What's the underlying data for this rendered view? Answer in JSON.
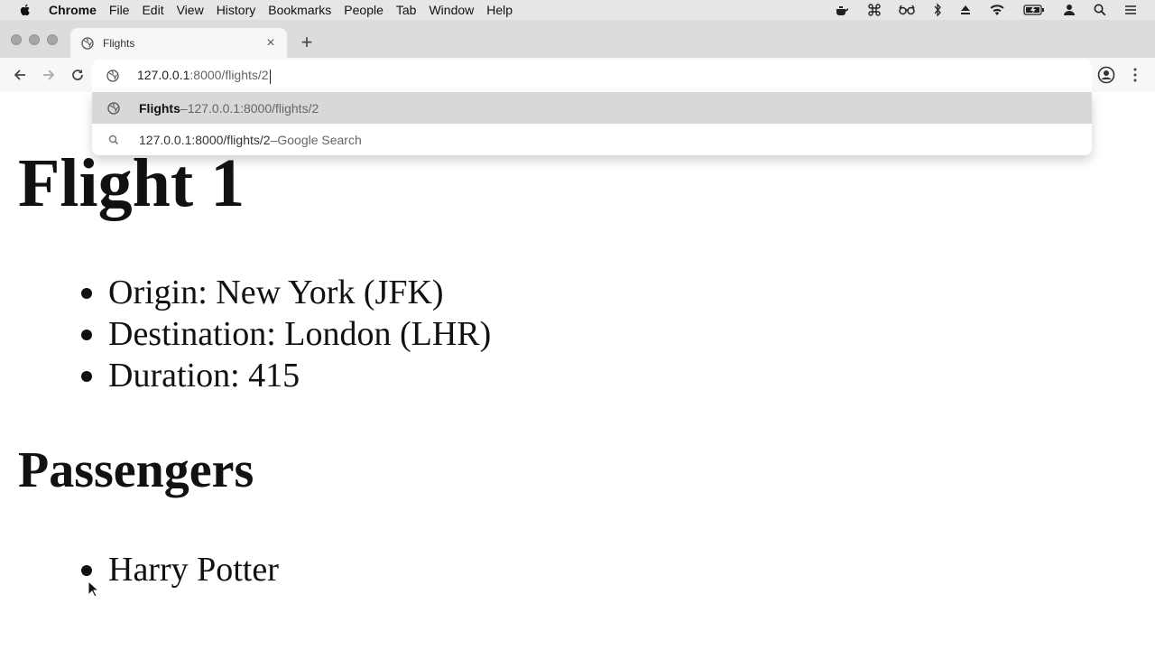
{
  "menubar": {
    "app_name": "Chrome",
    "items": [
      "File",
      "Edit",
      "View",
      "History",
      "Bookmarks",
      "People",
      "Tab",
      "Window",
      "Help"
    ],
    "status_icons": [
      "apple-icon",
      "teapot-icon",
      "command-icon",
      "glasses-icon",
      "bluetooth-icon",
      "eject-icon",
      "wifi-icon",
      "battery-icon",
      "user-icon",
      "search-icon",
      "list-icon"
    ]
  },
  "tab": {
    "title": "Flights",
    "favicon": "globe-icon",
    "close": "×"
  },
  "newtab": "+",
  "omnibox": {
    "host": "127.0.0.1",
    "rest": ":8000/flights/2"
  },
  "suggestions": [
    {
      "title": "Flights",
      "sep": " – ",
      "url": "127.0.0.1:8000/flights/2",
      "icon": "globe-icon"
    },
    {
      "text": "127.0.0.1:8000/flights/2",
      "sep": " – ",
      "suffix": "Google Search",
      "icon": "search-icon"
    }
  ],
  "page": {
    "heading": "Flight 1",
    "details": [
      "Origin: New York (JFK)",
      "Destination: London (LHR)",
      "Duration: 415"
    ],
    "passengers_heading": "Passengers",
    "passengers": [
      "Harry Potter"
    ]
  }
}
